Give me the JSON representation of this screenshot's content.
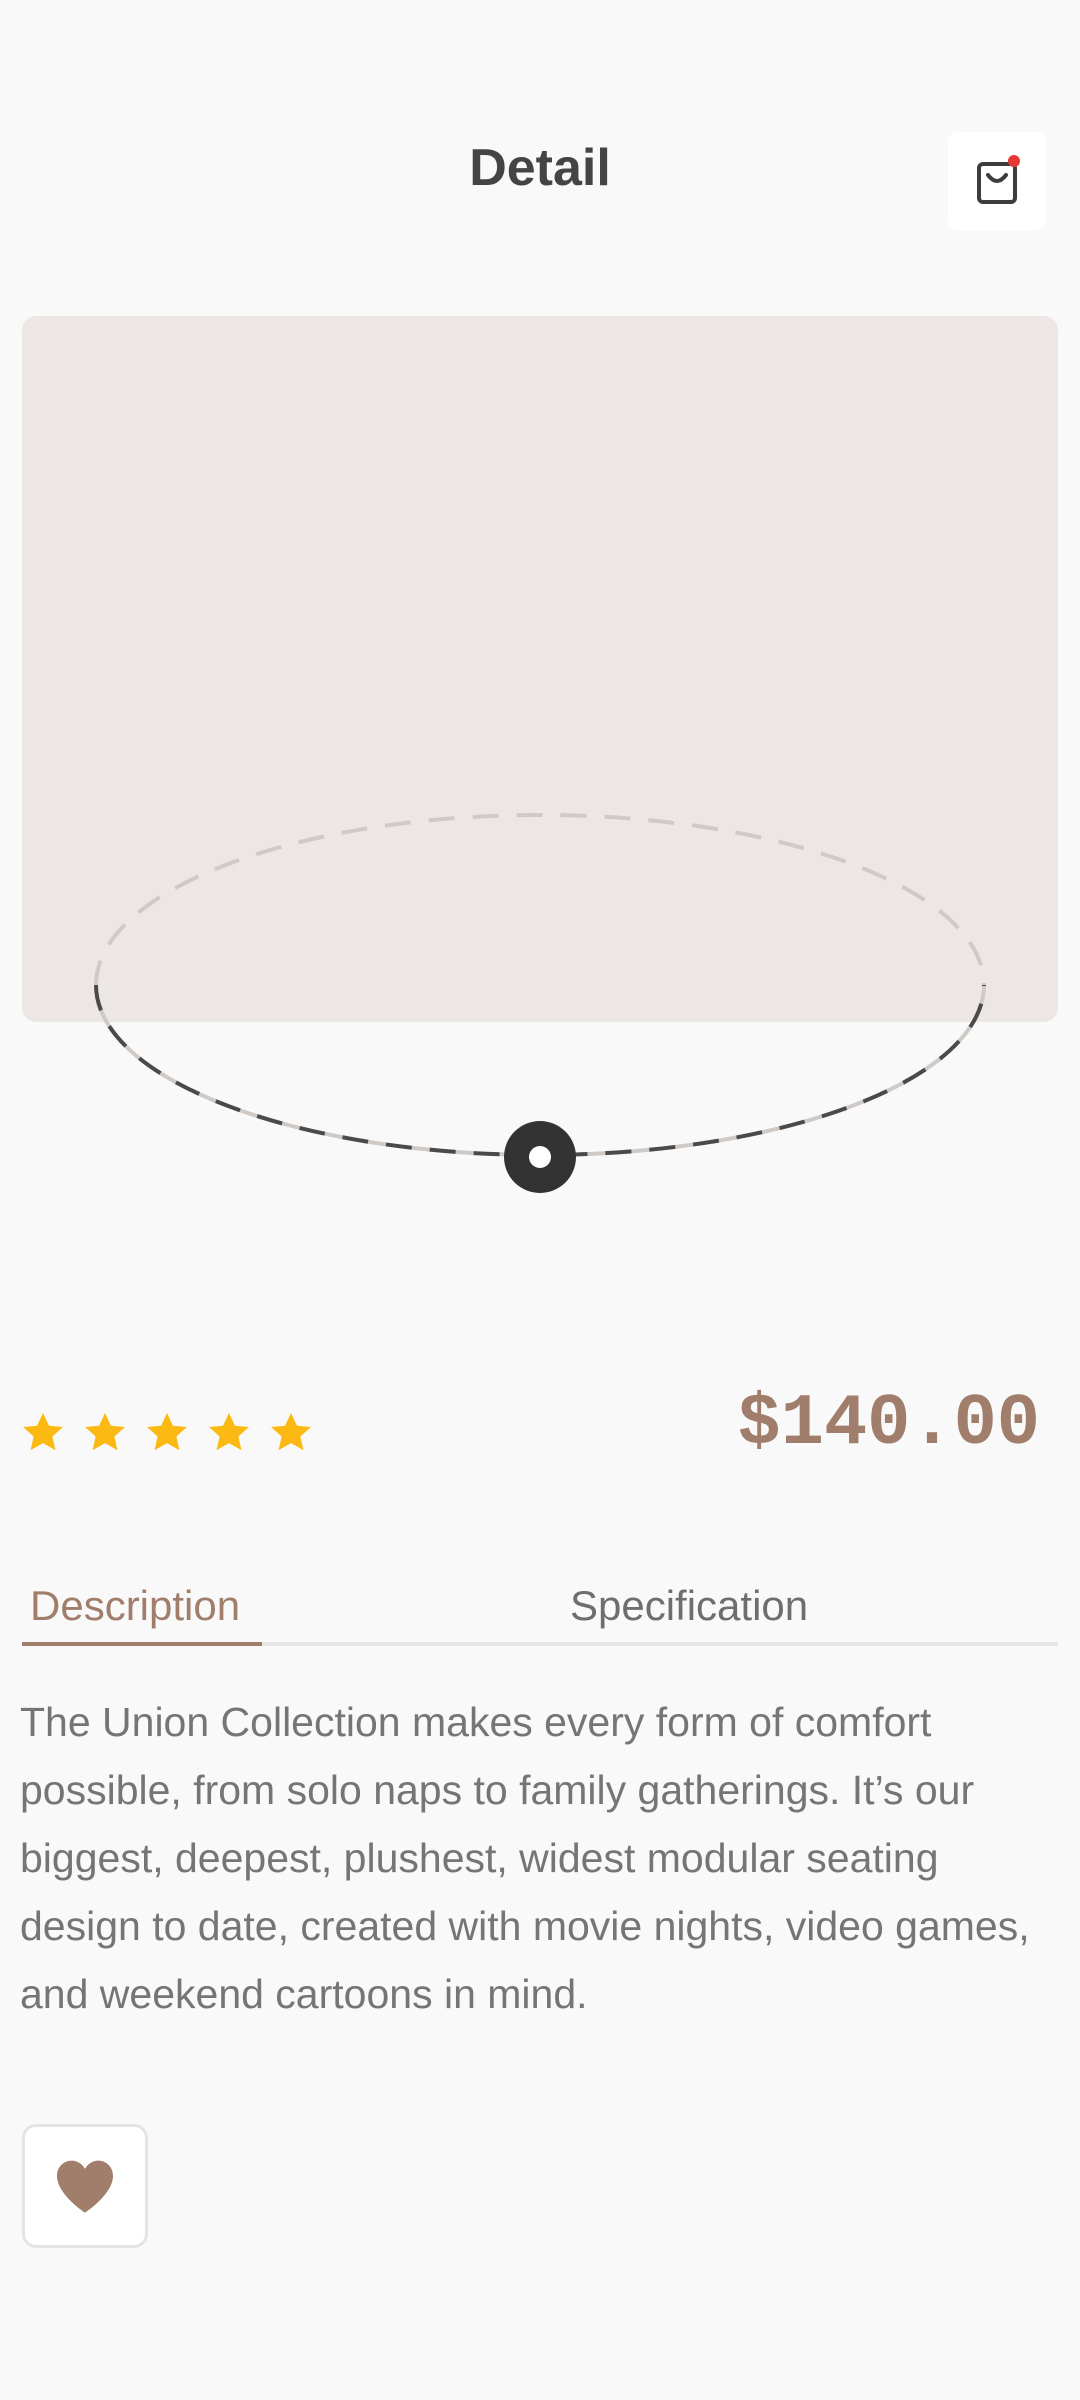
{
  "header": {
    "title": "Detail"
  },
  "cart": {
    "icon": "shopping-bag-icon",
    "has_notification": true,
    "notification_color": "#e53935"
  },
  "product": {
    "image_placeholder_color": "#ece7e4",
    "rating": 5,
    "rating_max": 5,
    "star_color": "#fdb913",
    "price": "$140.00",
    "accent_color": "#a07e6b"
  },
  "tabs": [
    {
      "label": "Description",
      "active": true
    },
    {
      "label": "Specification",
      "active": false
    }
  ],
  "description": {
    "text": "The Union Collection makes every form of comfort possible, from solo naps to family gatherings. It’s our biggest, deepest, plushest, widest modular seating design to date, created with movie nights, video games, and weekend cartoons in mind."
  },
  "favorite": {
    "icon": "heart-icon",
    "color": "#a07e6b"
  }
}
